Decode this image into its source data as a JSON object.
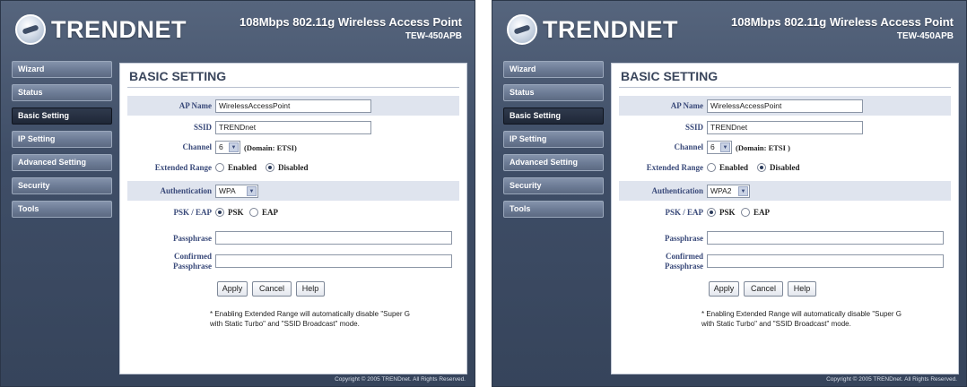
{
  "header": {
    "logo": "TRENDNET",
    "product_title": "108Mbps 802.11g Wireless Access Point",
    "model": "TEW-450APB"
  },
  "nav": [
    {
      "label": "Wizard"
    },
    {
      "label": "Status"
    },
    {
      "label": "Basic Setting"
    },
    {
      "label": "IP Setting"
    },
    {
      "label": "Advanced Setting"
    },
    {
      "label": "Security"
    },
    {
      "label": "Tools"
    }
  ],
  "page_title": "BASIC SETTING",
  "labels": {
    "ap_name": "AP Name",
    "ssid": "SSID",
    "channel": "Channel",
    "extended_range": "Extended Range",
    "enabled": "Enabled",
    "disabled": "Disabled",
    "authentication": "Authentication",
    "psk_eap": "PSK / EAP",
    "psk": "PSK",
    "eap": "EAP",
    "passphrase": "Passphrase",
    "confirmed": "Confirmed",
    "confirmed_passphrase": "Passphrase"
  },
  "buttons": {
    "apply": "Apply",
    "cancel": "Cancel",
    "help": "Help"
  },
  "note_line1": "* Enabling Extended Range will automatically disable \"Super G",
  "note_line2": "with Static Turbo\" and \"SSID Broadcast\" mode.",
  "copyright": "Copyright © 2005 TRENDnet. All Rights Reserved.",
  "left": {
    "ap_name_value": "WirelessAccessPoint",
    "ssid_value": "TRENDnet",
    "channel_value": "6",
    "domain": "(Domain: ETSI)",
    "authentication_value": "WPA",
    "passphrase_value": "",
    "confirmed_passphrase_value": ""
  },
  "right": {
    "ap_name_value": "WirelessAccessPoint",
    "ssid_value": "TRENDnet",
    "channel_value": "6",
    "domain": "(Domain: ETSI )",
    "authentication_value": "WPA2",
    "passphrase_value": "",
    "confirmed_passphrase_value": ""
  },
  "colors": {
    "panel_bg": "#3f4e67",
    "active_nav": "#1f2737",
    "label_blue": "#3a4a7a",
    "band": "#dfe4ee"
  }
}
